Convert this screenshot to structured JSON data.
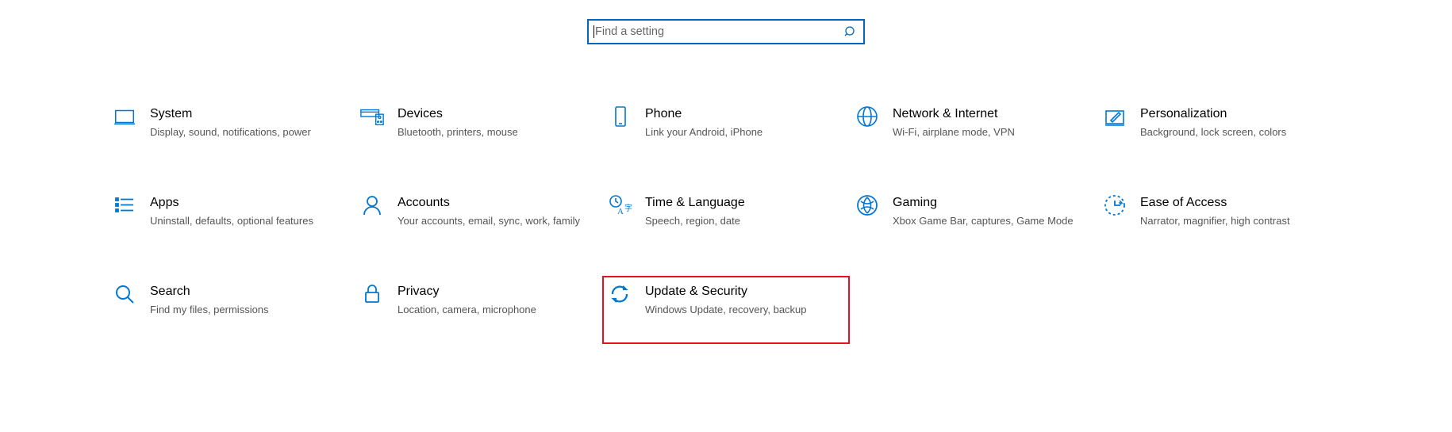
{
  "colors": {
    "accent": "#0078d4",
    "highlight_border": "#e81123",
    "search_border": "#0067c0"
  },
  "search": {
    "placeholder": "Find a setting"
  },
  "tiles": {
    "system": {
      "title": "System",
      "desc": "Display, sound, notifications, power"
    },
    "devices": {
      "title": "Devices",
      "desc": "Bluetooth, printers, mouse"
    },
    "phone": {
      "title": "Phone",
      "desc": "Link your Android, iPhone"
    },
    "network": {
      "title": "Network & Internet",
      "desc": "Wi-Fi, airplane mode, VPN"
    },
    "personalization": {
      "title": "Personalization",
      "desc": "Background, lock screen, colors"
    },
    "apps": {
      "title": "Apps",
      "desc": "Uninstall, defaults, optional features"
    },
    "accounts": {
      "title": "Accounts",
      "desc": "Your accounts, email, sync, work, family"
    },
    "time": {
      "title": "Time & Language",
      "desc": "Speech, region, date"
    },
    "gaming": {
      "title": "Gaming",
      "desc": "Xbox Game Bar, captures, Game Mode"
    },
    "ease": {
      "title": "Ease of Access",
      "desc": "Narrator, magnifier, high contrast"
    },
    "search_tile": {
      "title": "Search",
      "desc": "Find my files, permissions"
    },
    "privacy": {
      "title": "Privacy",
      "desc": "Location, camera, microphone"
    },
    "update": {
      "title": "Update & Security",
      "desc": "Windows Update, recovery, backup"
    }
  }
}
